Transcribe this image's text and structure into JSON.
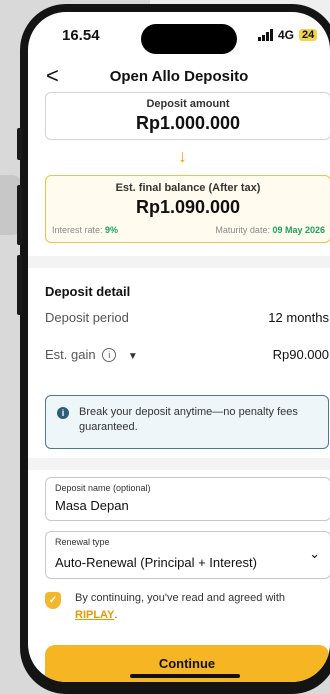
{
  "status_bar": {
    "time": "16.54",
    "network": "4G",
    "battery": "24"
  },
  "header": {
    "back_icon": "chevron-left-icon",
    "back_glyph": "<",
    "title": "Open Allo Deposito"
  },
  "deposit_amount": {
    "label": "Deposit amount",
    "value": "Rp1.000.000"
  },
  "arrow_glyph": "↓",
  "final_balance": {
    "label": "Est. final balance (After tax)",
    "value": "Rp1.090.000",
    "interest_label": "Interest rate: ",
    "interest_value": "9%",
    "maturity_label": "Maturity date: ",
    "maturity_value": "09 May 2026"
  },
  "deposit_detail": {
    "title": "Deposit detail",
    "period_label": "Deposit period",
    "period_value": "12 months",
    "gain_label": "Est. gain",
    "gain_value": "Rp90.000",
    "info_glyph": "i",
    "caret_glyph": "▼"
  },
  "info_banner": {
    "glyph": "i",
    "text": "Break your deposit anytime—no penalty fees guaranteed."
  },
  "deposit_name": {
    "label": "Deposit name (optional)",
    "value": "Masa Depan"
  },
  "renewal_type": {
    "label": "Renewal type",
    "value": "Auto-Renewal (Principal + Interest)",
    "chevron_glyph": "⌄"
  },
  "consent": {
    "icon_glyph": "✓",
    "text": "By continuing, you've read and agreed with ",
    "link": "RIPLAY",
    "suffix": "."
  },
  "continue_button": {
    "label": "Continue"
  },
  "colors": {
    "accent": "#f6b624",
    "link": "#e39b00",
    "success": "#1aa35c",
    "info": "#2c5d7a"
  }
}
